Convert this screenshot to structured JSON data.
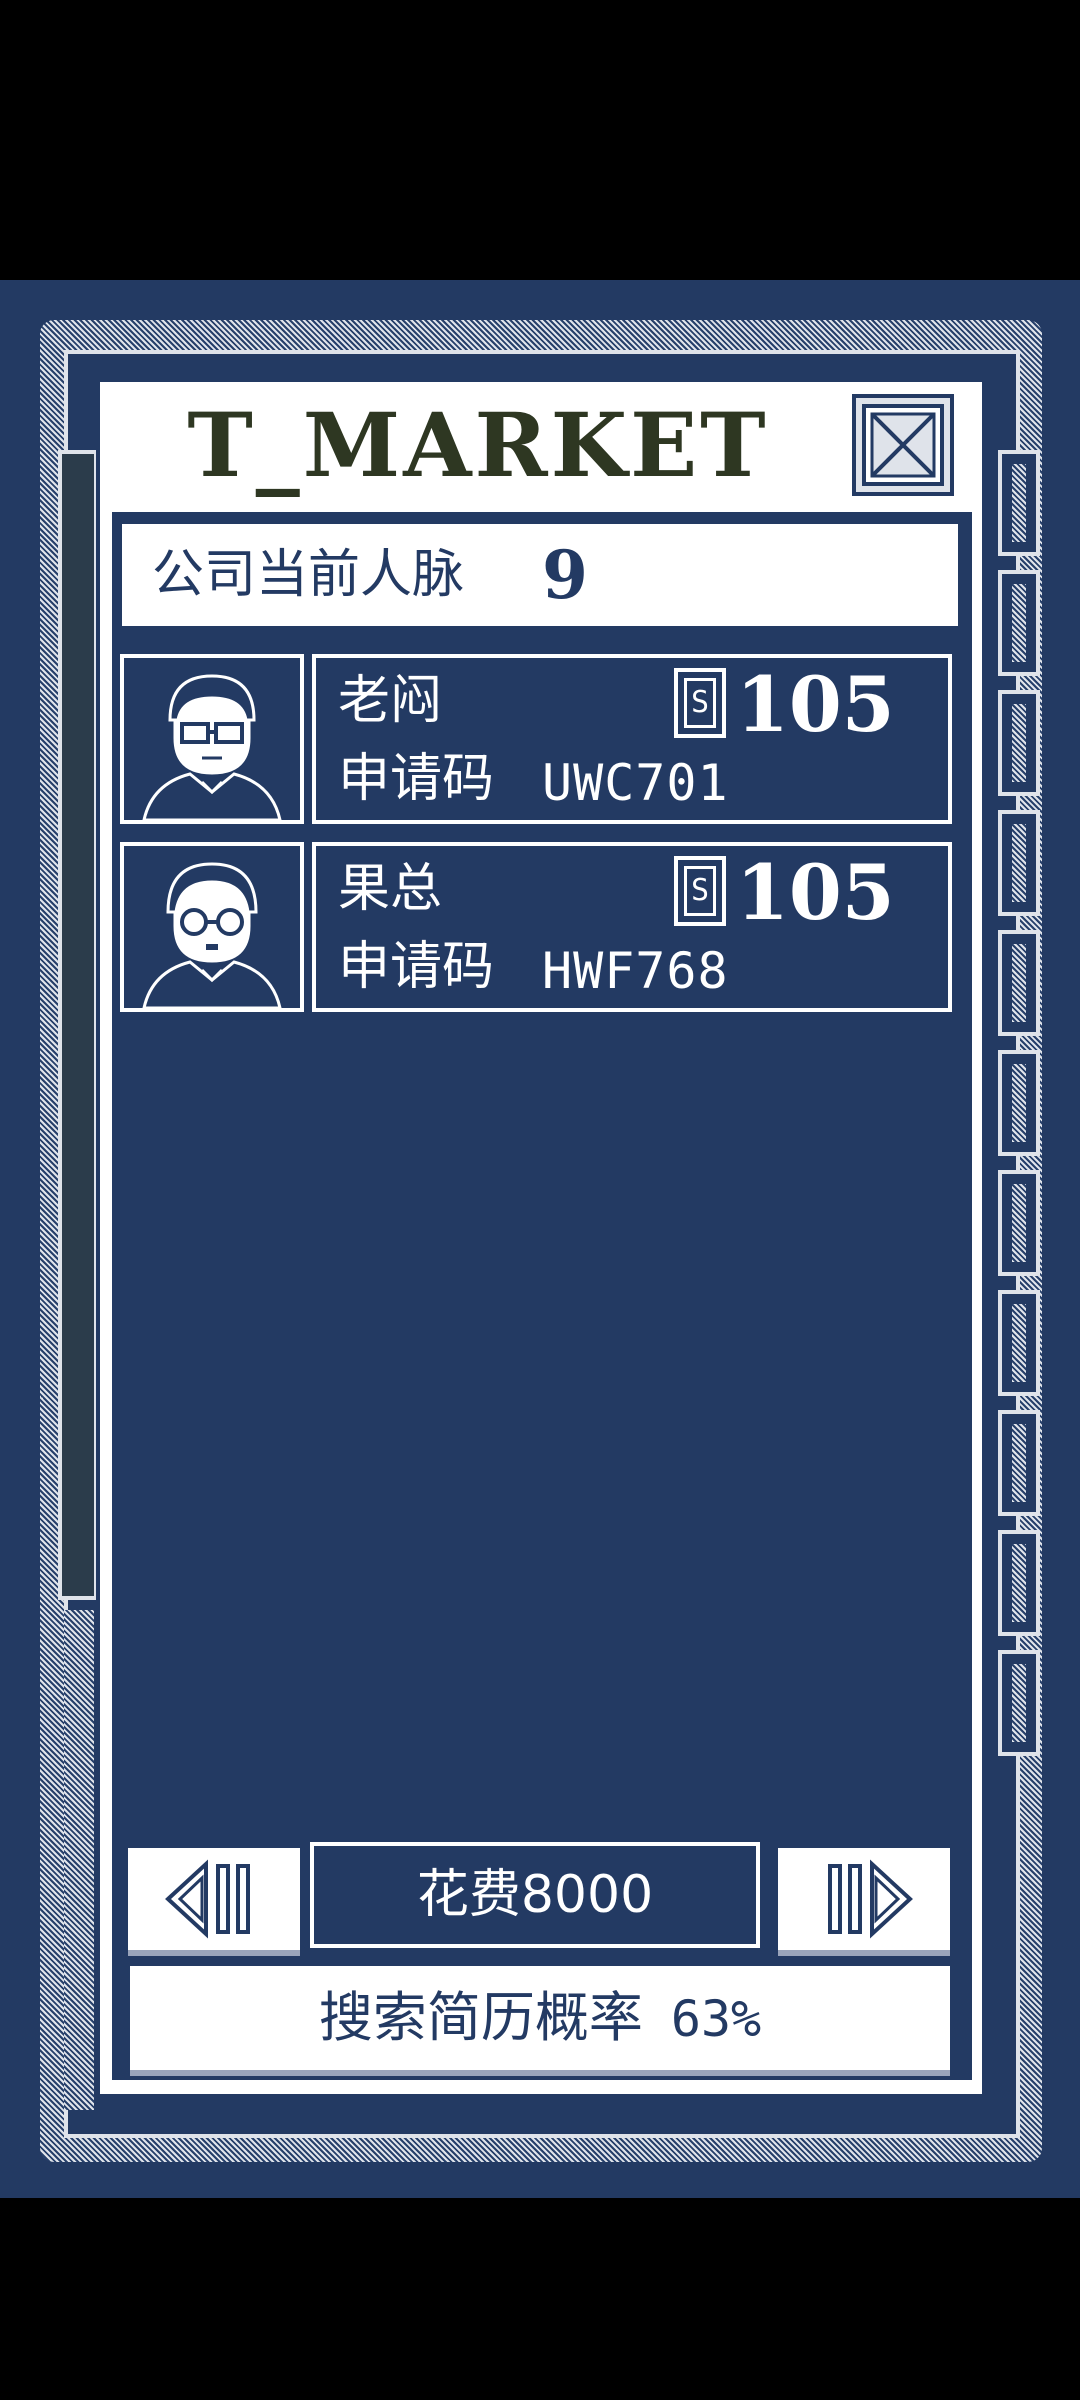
{
  "window": {
    "title": "T_MARKET",
    "close_icon": "close-x-icon"
  },
  "company": {
    "contacts_label": "公司当前人脉",
    "contacts_value": "9"
  },
  "candidates": [
    {
      "name": "老闷",
      "code_label": "申请码",
      "code": "UWC701",
      "salary_icon": "salary-s-icon",
      "salary_icon_text": "S",
      "salary": "105",
      "avatar": "glasses-man-avatar"
    },
    {
      "name": "果总",
      "code_label": "申请码",
      "code": "HWF768",
      "salary_icon": "salary-s-icon",
      "salary_icon_text": "S",
      "salary": "105",
      "avatar": "round-glasses-man-avatar"
    }
  ],
  "controls": {
    "prev_icon": "prev-arrow-icon",
    "next_icon": "next-arrow-icon",
    "cost_label": "花费8000"
  },
  "search": {
    "probability_label": "搜索简历概率",
    "probability_value": "63%"
  },
  "colors": {
    "background": "#233a63",
    "panel": "#ffffff",
    "title": "#2e3722",
    "border_light": "#dfe3ea"
  }
}
